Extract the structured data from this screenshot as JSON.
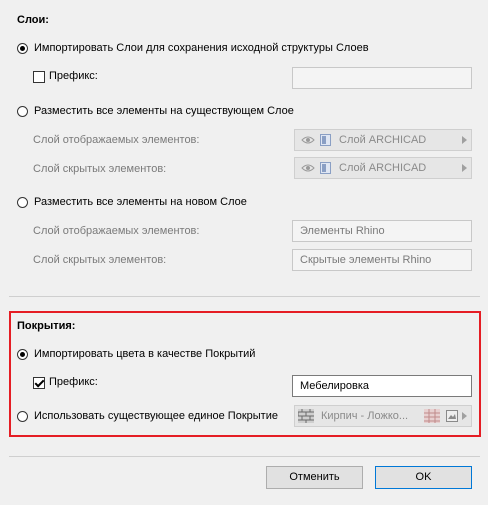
{
  "layers": {
    "heading": "Слои:",
    "import_option": "Импортировать Слои для сохранения исходной структуры Слоев",
    "prefix_label": "Префикс:",
    "prefix_value": "",
    "existing_option": "Разместить все элементы на существующем Слое",
    "visible_label": "Слой отображаемых элементов:",
    "hidden_label": "Слой скрытых элементов:",
    "existing_visible_value": "Слой ARCHICAD",
    "existing_hidden_value": "Слой ARCHICAD",
    "new_option": "Разместить все элементы на новом Слое",
    "new_visible_label": "Слой отображаемых элементов:",
    "new_hidden_label": "Слой скрытых элементов:",
    "new_visible_value": "Элементы Rhino",
    "new_hidden_value": "Скрытые элементы Rhino"
  },
  "surfaces": {
    "heading": "Покрытия:",
    "import_option": "Импортировать цвета в качестве Покрытий",
    "prefix_label": "Префикс:",
    "prefix_value": "Мебелировка",
    "existing_option": "Использовать существующее единое Покрытие",
    "surface_value": "Кирпич - Ложко..."
  },
  "buttons": {
    "cancel": "Отменить",
    "ok": "OK"
  },
  "colors": {
    "highlight": "#e51d24",
    "default_button_border": "#0078d7"
  }
}
